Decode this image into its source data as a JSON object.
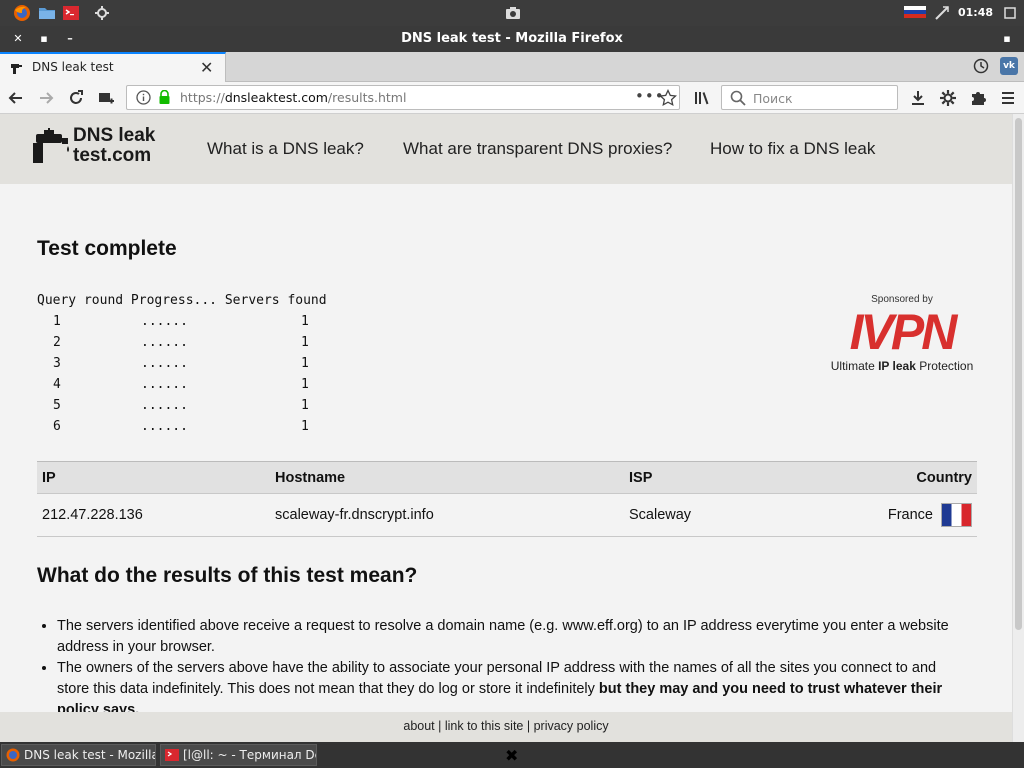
{
  "system_panel": {
    "apps": [
      "firefox-icon",
      "folder-icon",
      "terminal-icon",
      "settings-icon"
    ],
    "clock": "01:48"
  },
  "window": {
    "title": "DNS leak test - Mozilla Firefox"
  },
  "tab": {
    "title": "DNS leak test"
  },
  "navbar": {
    "url_prefix": "https://",
    "url_domain": "dnsleaktest.com",
    "url_path": "/results.html",
    "search_placeholder": "Поиск"
  },
  "site": {
    "logo_line1": "DNS leak",
    "logo_line2": "test.com",
    "nav": [
      "What is a DNS leak?",
      "What are transparent DNS proxies?",
      "How to fix a DNS leak"
    ]
  },
  "test": {
    "heading": "Test complete",
    "columns": "Query round Progress... Servers found",
    "rounds": [
      {
        "round": "1",
        "progress": "......",
        "servers": "1"
      },
      {
        "round": "2",
        "progress": "......",
        "servers": "1"
      },
      {
        "round": "3",
        "progress": "......",
        "servers": "1"
      },
      {
        "round": "4",
        "progress": "......",
        "servers": "1"
      },
      {
        "round": "5",
        "progress": "......",
        "servers": "1"
      },
      {
        "round": "6",
        "progress": "......",
        "servers": "1"
      }
    ]
  },
  "sponsor": {
    "label": "Sponsored by",
    "brand": "IVPN",
    "tagline_pre": "Ultimate ",
    "tagline_bold": "IP leak",
    "tagline_post": " Protection",
    "brand_color": "#d8302e"
  },
  "results_table": {
    "headers": [
      "IP",
      "Hostname",
      "ISP",
      "Country"
    ],
    "rows": [
      {
        "ip": "212.47.228.136",
        "hostname": "scaleway-fr.dnscrypt.info",
        "isp": "Scaleway",
        "country": "France",
        "flag": "france-flag-icon"
      }
    ]
  },
  "meaning": {
    "heading": "What do the results of this test mean?",
    "bullet1": "The servers identified above receive a request to resolve a domain name (e.g. www.eff.org) to an IP address everytime you enter a website address in your browser.",
    "bullet2_plain": "The owners of the servers above have the ability to associate your personal IP address with the names of all the sites you connect to and store this data indefinitely. This does not mean that they do log or store it indefinitely ",
    "bullet2_bold": "but they may and you need to trust whatever their policy says."
  },
  "footer": {
    "links": [
      "about",
      "link to this site",
      "privacy policy"
    ],
    "separator": " | "
  },
  "taskbar": {
    "tasks": [
      "DNS leak test - Mozilla ...",
      "[l@ll: ~ - Терминал De..."
    ]
  }
}
